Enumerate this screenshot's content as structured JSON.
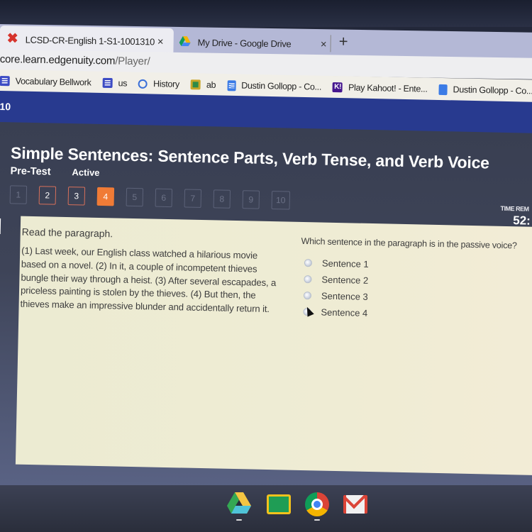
{
  "browser": {
    "tabs": [
      {
        "label": "LCSD-CR-English 1-S1-1001310",
        "icon": "edgenuity-x-icon",
        "active": true
      },
      {
        "label": "My Drive - Google Drive",
        "icon": "google-drive-icon",
        "active": false
      }
    ],
    "close_glyph": "×",
    "new_tab_glyph": "+",
    "url_host": "core.learn.edgenuity.com",
    "url_path": "/Player/",
    "bookmarks": [
      {
        "label": "Vocabulary Bellwork",
        "icon": "list-icon"
      },
      {
        "label": "us",
        "icon": "list-icon"
      },
      {
        "label": "History",
        "icon": "history-clock-icon"
      },
      {
        "label": "ab",
        "icon": "classroom-icon"
      },
      {
        "label": "Dustin Gollopp - Co...",
        "icon": "docs-icon"
      },
      {
        "label": "Play Kahoot! - Ente...",
        "icon": "kahoot-icon"
      },
      {
        "label": "Dustin Gollopp - Co...",
        "icon": "slides-icon"
      }
    ]
  },
  "app": {
    "header_number": "10",
    "title": "Simple Sentences: Sentence Parts, Verb Tense, and Verb Voice",
    "assessment_type": "Pre-Test",
    "status": "Active",
    "questions": [
      {
        "label": "1",
        "state": "unanswered"
      },
      {
        "label": "2",
        "state": "answered"
      },
      {
        "label": "3",
        "state": "answered"
      },
      {
        "label": "4",
        "state": "current"
      },
      {
        "label": "5",
        "state": "unanswered"
      },
      {
        "label": "6",
        "state": "unanswered"
      },
      {
        "label": "7",
        "state": "unanswered"
      },
      {
        "label": "8",
        "state": "unanswered"
      },
      {
        "label": "9",
        "state": "unanswered"
      },
      {
        "label": "10",
        "state": "unanswered"
      }
    ],
    "timer_label": "TIME REM",
    "timer_value": "52:",
    "accent_color": "#f07b36"
  },
  "question": {
    "instruction": "Read the paragraph.",
    "passage": "(1) Last week, our English class watched a hilarious movie based on a novel. (2) In it, a couple of incompetent thieves bungle their way through a heist. (3) After several escapades, a priceless painting is stolen by the thieves. (4) But then, the thieves make an impressive blunder and accidentally return it.",
    "prompt": "Which sentence in the paragraph is in the passive voice?",
    "options": [
      "Sentence 1",
      "Sentence 2",
      "Sentence 3",
      "Sentence 4"
    ]
  },
  "shelf": {
    "apps": [
      "google-drive-icon",
      "google-classroom-icon",
      "chrome-icon",
      "gmail-icon"
    ]
  }
}
